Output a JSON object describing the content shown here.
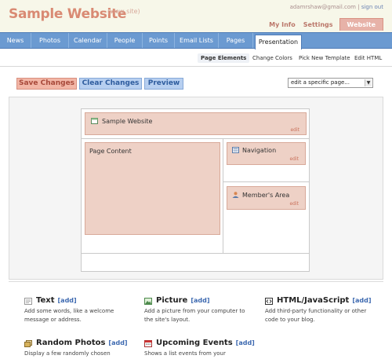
{
  "header": {
    "site_title": "Sample Website",
    "view_site": "(view site)",
    "user_email": "adamrshaw@gmail.com",
    "separator": "|",
    "sign_out": "sign out",
    "tabs": [
      {
        "label": "My Info"
      },
      {
        "label": "Settings"
      },
      {
        "label": "Website"
      }
    ]
  },
  "nav": {
    "tabs": [
      {
        "label": "News"
      },
      {
        "label": "Photos"
      },
      {
        "label": "Calendar"
      },
      {
        "label": "People"
      },
      {
        "label": "Points"
      },
      {
        "label": "Email Lists"
      },
      {
        "label": "Pages"
      },
      {
        "label": "Presentation"
      }
    ],
    "active": "Presentation"
  },
  "subnav": {
    "tabs": [
      {
        "label": "Page Elements"
      },
      {
        "label": "Change Colors"
      },
      {
        "label": "Pick New Template"
      },
      {
        "label": "Edit HTML"
      }
    ],
    "active": "Page Elements"
  },
  "actions": {
    "save": "Save Changes",
    "clear": "Clear Changes",
    "preview": "Preview",
    "page_select": "edit a specific page..."
  },
  "layout": {
    "header_element": {
      "label": "Sample Website",
      "edit": "edit"
    },
    "content_element": {
      "label": "Page Content"
    },
    "navigation_element": {
      "label": "Navigation",
      "edit": "edit"
    },
    "members_element": {
      "label": "Member's Area",
      "edit": "edit"
    }
  },
  "widgets": [
    {
      "icon": "text-icon",
      "title": "Text",
      "add": "[add]",
      "desc": "Add some words, like a welcome message or address."
    },
    {
      "icon": "picture-icon",
      "title": "Picture",
      "add": "[add]",
      "desc": "Add a picture from your computer to the site's layout."
    },
    {
      "icon": "html-icon",
      "title": "HTML/JavaScript",
      "add": "[add]",
      "desc": "Add third-party functionality or other code to your blog."
    },
    {
      "icon": "photos-icon",
      "title": "Random Photos",
      "add": "[add]",
      "desc": "Display a few randomly chosen"
    },
    {
      "icon": "calendar-icon",
      "title": "Upcoming Events",
      "add": "[add]",
      "desc": "Shows a list events from your"
    }
  ],
  "colors": {
    "accent": "#d98a73",
    "nav_bar": "#6b9ad1",
    "element_fill": "#eed1c6",
    "link": "#3d69b0"
  }
}
